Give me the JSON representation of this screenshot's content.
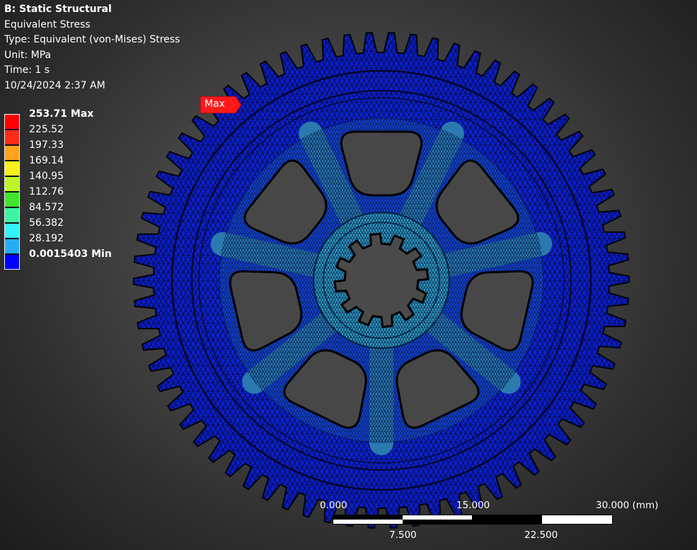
{
  "header": {
    "title": "B: Static Structural",
    "result": "Equivalent Stress",
    "type": "Type: Equivalent (von-Mises) Stress",
    "unit": "Unit: MPa",
    "time": "Time: 1 s",
    "date": "10/24/2024 2:37 AM"
  },
  "legend": {
    "entries": [
      {
        "label": "253.71 Max",
        "color": "#ff0000",
        "bold": true
      },
      {
        "label": "225.52",
        "color": "#ff2a1a",
        "bold": false
      },
      {
        "label": "197.33",
        "color": "#ffa21c",
        "bold": false
      },
      {
        "label": "169.14",
        "color": "#f6f11e",
        "bold": false
      },
      {
        "label": "140.95",
        "color": "#bdf52a",
        "bold": false
      },
      {
        "label": "112.76",
        "color": "#40e52c",
        "bold": false
      },
      {
        "label": "84.572",
        "color": "#3cf5a3",
        "bold": false
      },
      {
        "label": "56.382",
        "color": "#33f2f5",
        "bold": false
      },
      {
        "label": "28.192",
        "color": "#25aef5",
        "bold": false
      },
      {
        "label": "0.0015403 Min",
        "color": "#0000ff",
        "bold": true
      }
    ]
  },
  "probe": {
    "label": "Max",
    "color": "#ff1a1a"
  },
  "scale": {
    "top_labels": [
      "0.000",
      "15.000",
      "30.000 (mm)"
    ],
    "bottom_labels": [
      "7.500",
      "22.500"
    ]
  },
  "model": {
    "teeth": 70,
    "windows": 7,
    "splines": 12,
    "colors": {
      "low": "#0a1fd6",
      "mesh": "#050a40",
      "web": "#2a7ab0",
      "hub": "#2f9fbf",
      "hole": "#474747"
    }
  }
}
